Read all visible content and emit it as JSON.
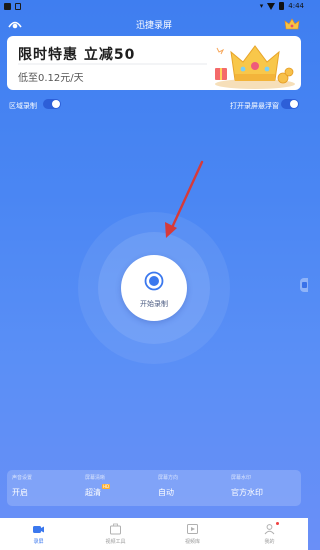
{
  "status_bar": {
    "time": "4:44"
  },
  "header": {
    "title": "迅捷录屏",
    "logo_icon": "eye-logo-icon",
    "vip_icon": "crown-icon"
  },
  "banner": {
    "title": "限时特惠  立减50",
    "subtitle": "低至0.12元/天"
  },
  "toggles": {
    "region_record": "区域录制",
    "floating_window": "打开录屏悬浮窗"
  },
  "record_button": {
    "label": "开始录制"
  },
  "settings": [
    {
      "label": "声音设置",
      "value": "开启"
    },
    {
      "label": "屏幕清晰",
      "value": "超清",
      "badge": "HD"
    },
    {
      "label": "屏幕方向",
      "value": "自动"
    },
    {
      "label": "屏幕水印",
      "value": "官方水印"
    }
  ],
  "tabs": [
    {
      "label": "录屏",
      "icon": "camera-icon",
      "active": true
    },
    {
      "label": "视频工具",
      "icon": "toolbox-icon",
      "active": false
    },
    {
      "label": "视频库",
      "icon": "video-library-icon",
      "active": false
    },
    {
      "label": "我的",
      "icon": "profile-icon",
      "active": false
    }
  ],
  "colors": {
    "primary": "#3b78ee",
    "background_top": "#3f7ef0",
    "background_bottom": "#6a8ff7",
    "arrow": "#d63a3a"
  }
}
